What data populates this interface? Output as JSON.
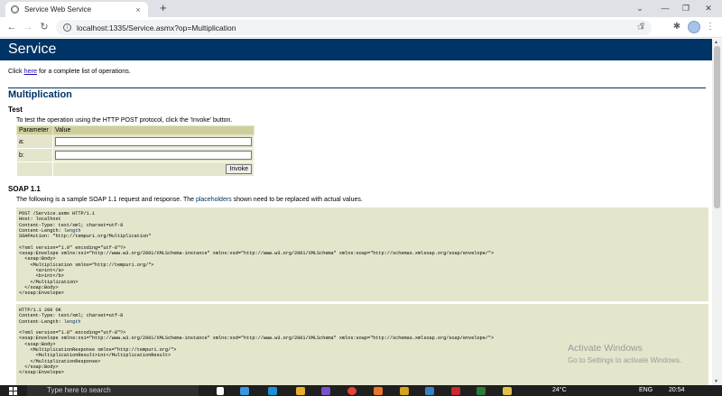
{
  "browser": {
    "tab_title": "Service Web Service",
    "tab_close": "×",
    "new_tab": "+",
    "url": "localhost:1335/Service.asmx?op=Multiplication",
    "window_controls": [
      "⌄",
      "—",
      "❐",
      "✕"
    ],
    "toolbar_icons": [
      "share-icon",
      "star-icon",
      "extensions-icon",
      "sidebar-icon",
      "profile-icon",
      "menu-icon"
    ]
  },
  "page": {
    "banner_title": "Service",
    "intro_before": "Click ",
    "intro_link": "here",
    "intro_after": " for a complete list of operations.",
    "operation_title": "Multiplication",
    "test_heading": "Test",
    "test_text": "To test the operation using the HTTP POST protocol, click the 'Invoke' button.",
    "params_header": [
      "Parameter",
      "Value"
    ],
    "params": [
      {
        "name": "a:",
        "value": ""
      },
      {
        "name": "b:",
        "value": ""
      }
    ],
    "invoke_label": "Invoke",
    "soap_heading": "SOAP 1.1",
    "soap_text_before": "The following is a sample SOAP 1.1 request and response. The ",
    "soap_text_link": "placeholders",
    "soap_text_after": " shown need to be replaced with actual values.",
    "request_lines": [
      "POST /Service.asmx HTTP/1.1",
      "Host: localhost",
      "Content-Type: text/xml; charset=utf-8",
      "Content-Length: length",
      "SOAPAction: \"http://tempuri.org/Multiplication\"",
      "",
      "<?xml version=\"1.0\" encoding=\"utf-8\"?>",
      "<soap:Envelope xmlns:xsi=\"http://www.w3.org/2001/XMLSchema-instance\" xmlns:xsd=\"http://www.w3.org/2001/XMLSchema\" xmlns:soap=\"http://schemas.xmlsoap.org/soap/envelope/\">",
      "  <soap:Body>",
      "    <Multiplication xmlns=\"http://tempuri.org/\">",
      "      <a>int</a>",
      "      <b>int</b>",
      "    </Multiplication>",
      "  </soap:Body>",
      "</soap:Envelope>"
    ],
    "response_lines": [
      "HTTP/1.1 200 OK",
      "Content-Type: text/xml; charset=utf-8",
      "Content-Length: length",
      "",
      "<?xml version=\"1.0\" encoding=\"utf-8\"?>",
      "<soap:Envelope xmlns:xsi=\"http://www.w3.org/2001/XMLSchema-instance\" xmlns:xsd=\"http://www.w3.org/2001/XMLSchema\" xmlns:soap=\"http://schemas.xmlsoap.org/soap/envelope/\">",
      "  <soap:Body>",
      "    <MultiplicationResponse xmlns=\"http://tempuri.org/\">",
      "      <MultiplicationResult>int</MultiplicationResult>",
      "    </MultiplicationResponse>",
      "  </soap:Body>",
      "</soap:Envelope>"
    ]
  },
  "watermark": {
    "title": "Activate Windows",
    "subtitle": "Go to Settings to activate Windows."
  },
  "taskbar": {
    "search_placeholder": "Type here to search",
    "weather": "24°C",
    "language": "ENG",
    "time": "20:54"
  },
  "colors": {
    "banner": "#003366",
    "code_bg": "#e5e5cc",
    "table_header": "#cecf9c",
    "link": "#1a0dab"
  }
}
